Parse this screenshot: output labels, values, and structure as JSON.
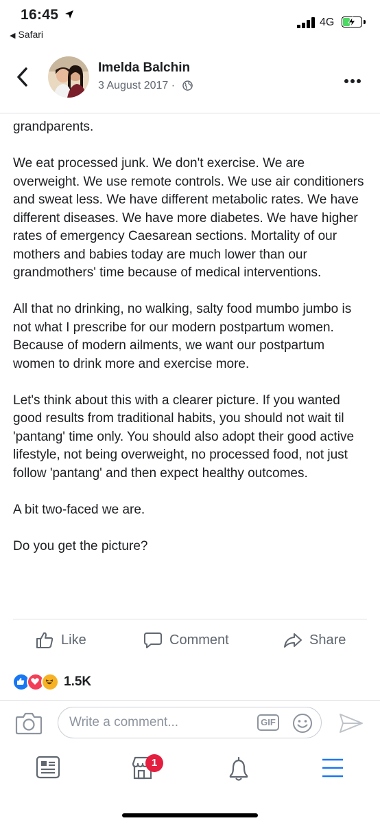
{
  "status_bar": {
    "time": "16:45",
    "back_app": "Safari",
    "network": "4G",
    "battery_level": 0.4,
    "icons": [
      "location-arrow-icon",
      "signal-bars-icon",
      "battery-charging-icon"
    ]
  },
  "post": {
    "author": "Imelda Balchin",
    "date": "3 August 2017",
    "separator": "·",
    "privacy_icon": "globe-icon",
    "paragraphs": [
      "grandparents.",
      "We eat processed junk. We don't exercise. We are overweight. We use remote controls. We use air conditioners and sweat less. We have different metabolic rates. We have different diseases. We have more diabetes. We have higher rates of emergency Caesarean sections. Mortality of our mothers and babies today are much lower than our grandmothers' time because of medical interventions.",
      "All that no drinking, no walking, salty food mumbo jumbo is not what I prescribe for our modern postpartum women. Because of modern ailments, we want our postpartum women to drink more and exercise more.",
      "Let's think about this with a clearer picture. If you wanted good results from traditional habits, you should not wait til 'pantang' time only. You should also adopt their good active lifestyle, not being overweight, no processed food, not just follow 'pantang' and then expect healthy outcomes.",
      "A bit two-faced we are.",
      "Do you get the picture?"
    ]
  },
  "actions": {
    "like": "Like",
    "comment": "Comment",
    "share": "Share"
  },
  "reactions": {
    "count": "1.5K",
    "types": [
      "like",
      "love",
      "haha"
    ]
  },
  "composer": {
    "placeholder": "Write a comment...",
    "gif_label": "GIF"
  },
  "bottom_nav": {
    "items": [
      "news-feed-icon",
      "marketplace-icon",
      "notifications-icon",
      "menu-icon"
    ],
    "marketplace_badge": "1"
  },
  "colors": {
    "accent": "#1877f2",
    "badge": "#e41e3f",
    "muted": "#606770"
  }
}
